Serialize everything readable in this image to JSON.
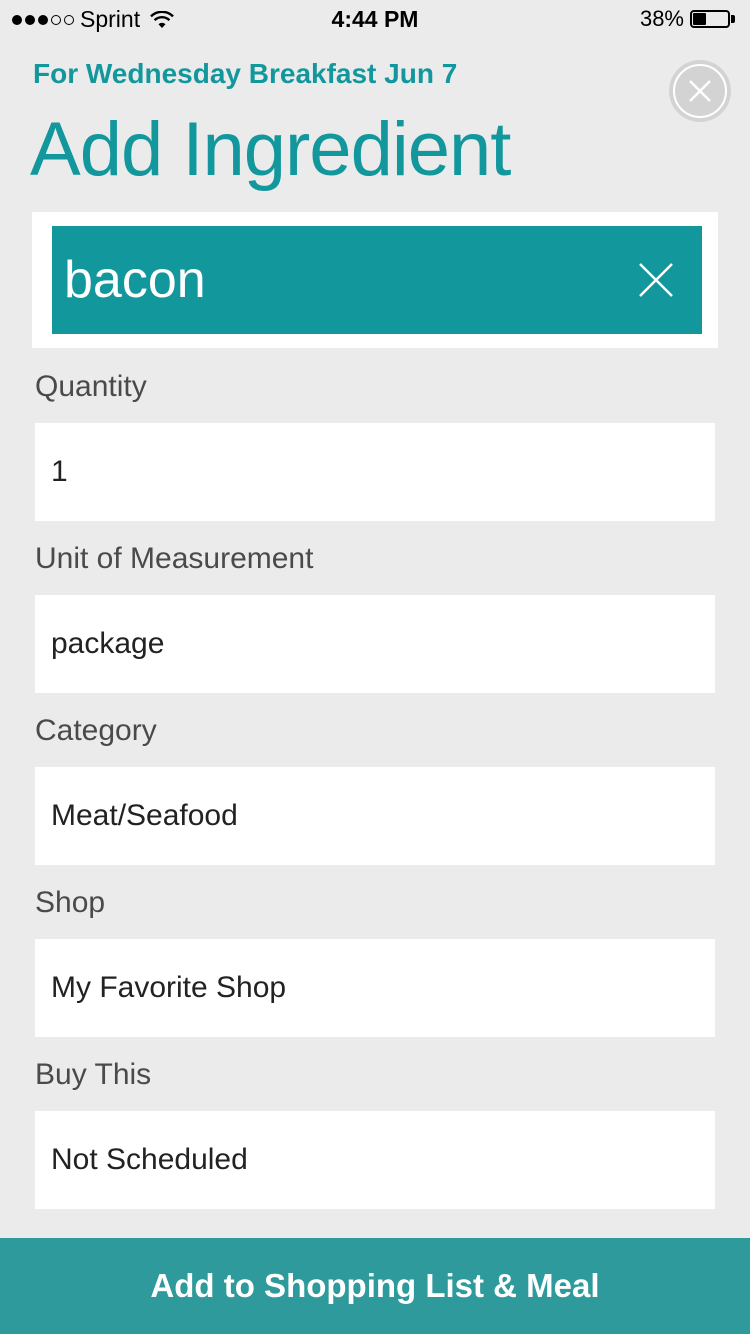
{
  "status_bar": {
    "carrier": "Sprint",
    "time": "4:44 PM",
    "battery_percent_label": "38%",
    "battery_level": 0.38,
    "signal_filled": 3,
    "signal_total": 5
  },
  "header": {
    "subtitle": "For Wednesday Breakfast Jun 7",
    "title": "Add Ingredient",
    "close_icon": "close-circle-icon"
  },
  "search": {
    "value": "bacon",
    "clear_icon": "clear-x-icon"
  },
  "fields": {
    "quantity": {
      "label": "Quantity",
      "value": "1"
    },
    "unit": {
      "label": "Unit of Measurement",
      "value": "package"
    },
    "category": {
      "label": "Category",
      "value": "Meat/Seafood"
    },
    "shop": {
      "label": "Shop",
      "value": "My Favorite Shop"
    },
    "buy_this": {
      "label": "Buy This",
      "value": "Not Scheduled"
    }
  },
  "actions": {
    "submit_label": "Add to Shopping List & Meal"
  },
  "colors": {
    "accent": "#12979c",
    "button": "#2e9a9b",
    "background": "#ebebeb"
  }
}
